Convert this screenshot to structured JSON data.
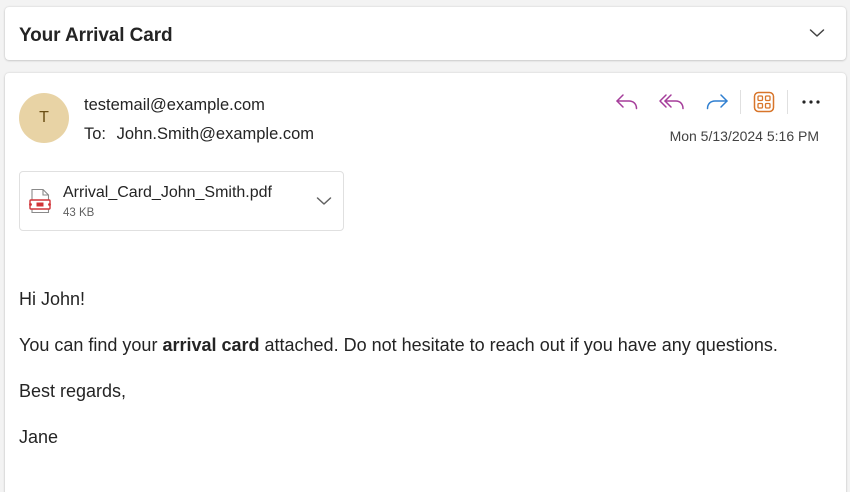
{
  "subject": {
    "title": "Your Arrival Card"
  },
  "message": {
    "avatar_initial": "T",
    "avatar_color": "#e8d3a5",
    "from": "testemail@example.com",
    "to_label": "To:",
    "to": "John.Smith@example.com",
    "date": "Mon 5/13/2024 5:16 PM",
    "actions": {
      "reply_icon": "reply-icon",
      "reply_all_icon": "reply-all-icon",
      "forward_icon": "forward-icon",
      "apps_icon": "apps-icon",
      "more_icon": "more-icon"
    },
    "accent_colors": {
      "reply": "#a53d9a",
      "forward": "#2f7fd0",
      "apps": "#d8752a"
    }
  },
  "attachment": {
    "name": "Arrival_Card_John_Smith.pdf",
    "size": "43 KB",
    "icon": "pdf-file-icon"
  },
  "body": {
    "greeting": "Hi John!",
    "line_before": "You can find your ",
    "line_bold": "arrival card",
    "line_after": " attached. Do not hesitate to reach out if you have any questions.",
    "regards": "Best regards,",
    "signature": "Jane"
  }
}
